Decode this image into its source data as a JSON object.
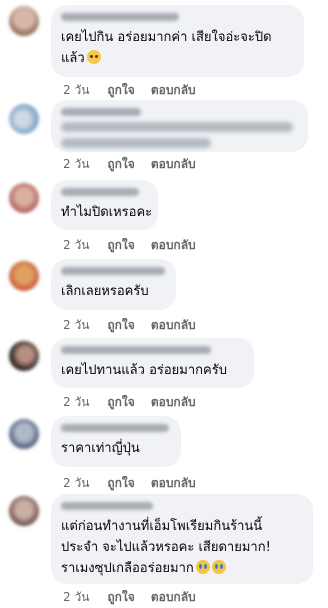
{
  "actions": {
    "time": "2 วัน",
    "like": "ถูกใจ",
    "reply": "ตอบกลับ"
  },
  "comments": [
    {
      "lines": [
        "เคยไปกิน อร่อยมากค่า เสียใจอ่ะจะปิด",
        "แล้ว"
      ],
      "emoji": "sad-face-emoji",
      "avatar_colors": [
        "#d9b7a6",
        "#8f6b58"
      ]
    },
    {
      "lines": [],
      "blurred_text": true,
      "avatar_colors": [
        "#7fa4c9",
        "#cfd9e3"
      ]
    },
    {
      "lines": [
        "ทำไมปิดเหรอคะ"
      ],
      "avatar_colors": [
        "#b25a5a",
        "#d8b0a0"
      ]
    },
    {
      "lines": [
        "เลิกเลยหรอครับ"
      ],
      "avatar_colors": [
        "#c8593a",
        "#e0a060"
      ]
    },
    {
      "lines": [
        "เคยไปทานแล้ว อร่อยมากครับ"
      ],
      "avatar_colors": [
        "#2e2424",
        "#b89080"
      ]
    },
    {
      "lines": [
        "ราคาเท่าญี่ปุ่น"
      ],
      "avatar_colors": [
        "#4a5b78",
        "#aeb8c8"
      ]
    },
    {
      "lines": [
        "แต่ก่อนทำงานที่เอ็มโพเรียมกินร้านนี้",
        "ประจำ จะไปแล้วหรอคะ เสียดายมาก!",
        "ราเมงซุปเกลืออร่อยมาก"
      ],
      "emoji": "crying-face-emoji",
      "avatar_colors": [
        "#6a4a44",
        "#c9b0a6"
      ]
    }
  ]
}
